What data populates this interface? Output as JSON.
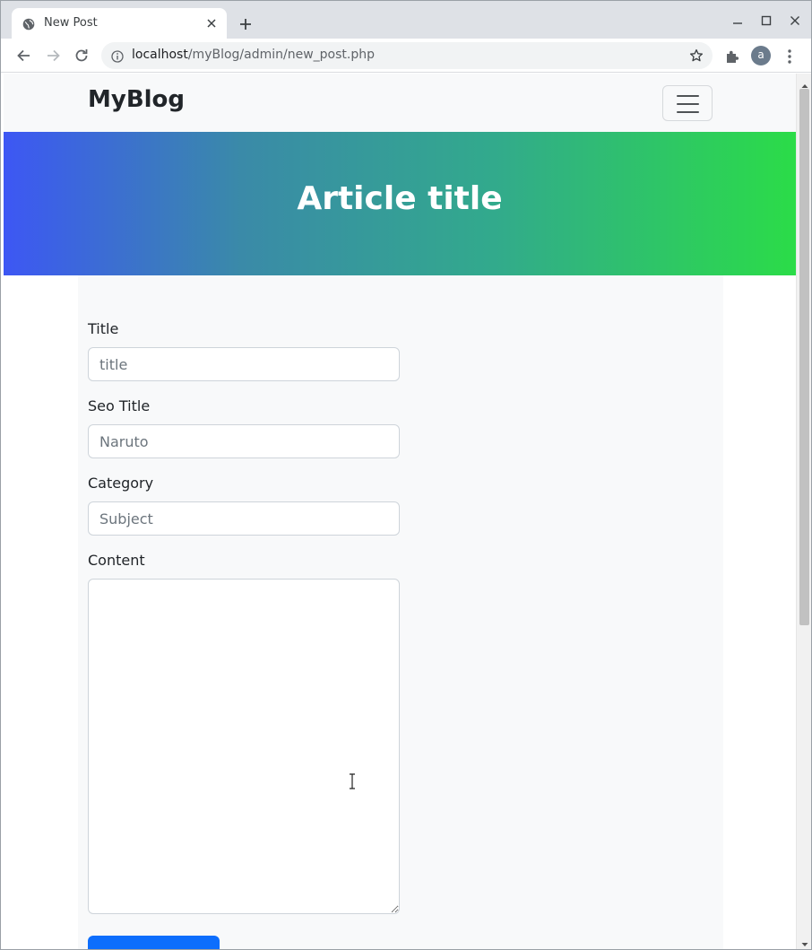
{
  "browser": {
    "tab_title": "New Post",
    "url_host": "localhost",
    "url_path": "/myBlog/admin/new_post.php",
    "profile_initial": "a"
  },
  "navbar": {
    "brand": "MyBlog"
  },
  "hero": {
    "title": "Article title",
    "gradient_start": "#3d57f4",
    "gradient_end": "#2bdc48"
  },
  "form": {
    "title_label": "Title",
    "title_placeholder": "title",
    "seo_label": "Seo Title",
    "seo_placeholder": "Naruto",
    "category_label": "Category",
    "category_placeholder": "Subject",
    "content_label": "Content",
    "content_value": ""
  },
  "colors": {
    "primary_button": "#0d6efd",
    "navbar_bg": "#f8f9fa"
  }
}
